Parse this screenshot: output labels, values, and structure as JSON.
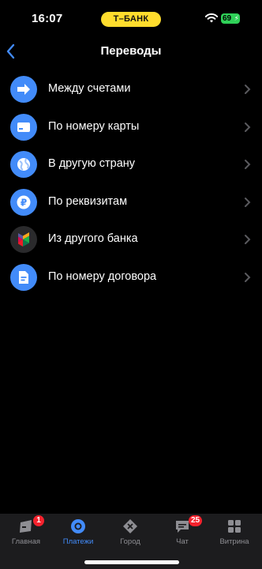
{
  "status": {
    "time": "16:07",
    "bank_pill": "Т–БАНК",
    "battery": "69"
  },
  "header": {
    "title": "Переводы"
  },
  "items": [
    {
      "label": "Между счетами",
      "icon": "arrow-right-icon"
    },
    {
      "label": "По номеру карты",
      "icon": "card-icon"
    },
    {
      "label": "В другую страну",
      "icon": "globe-icon"
    },
    {
      "label": "По реквизитам",
      "icon": "ruble-icon"
    },
    {
      "label": "Из другого банка",
      "icon": "sbp-icon"
    },
    {
      "label": "По номеру договора",
      "icon": "document-icon"
    }
  ],
  "tabs": [
    {
      "label": "Главная",
      "badge": "1",
      "icon": "home-icon"
    },
    {
      "label": "Платежи",
      "badge": "",
      "icon": "payments-icon",
      "active": true
    },
    {
      "label": "Город",
      "badge": "",
      "icon": "city-icon"
    },
    {
      "label": "Чат",
      "badge": "25",
      "icon": "chat-icon"
    },
    {
      "label": "Витрина",
      "badge": "",
      "icon": "showcase-icon"
    }
  ],
  "colors": {
    "accent": "#428bf9",
    "pill": "#ffdd2d",
    "badge": "#f5222d",
    "battery": "#2fd158"
  }
}
